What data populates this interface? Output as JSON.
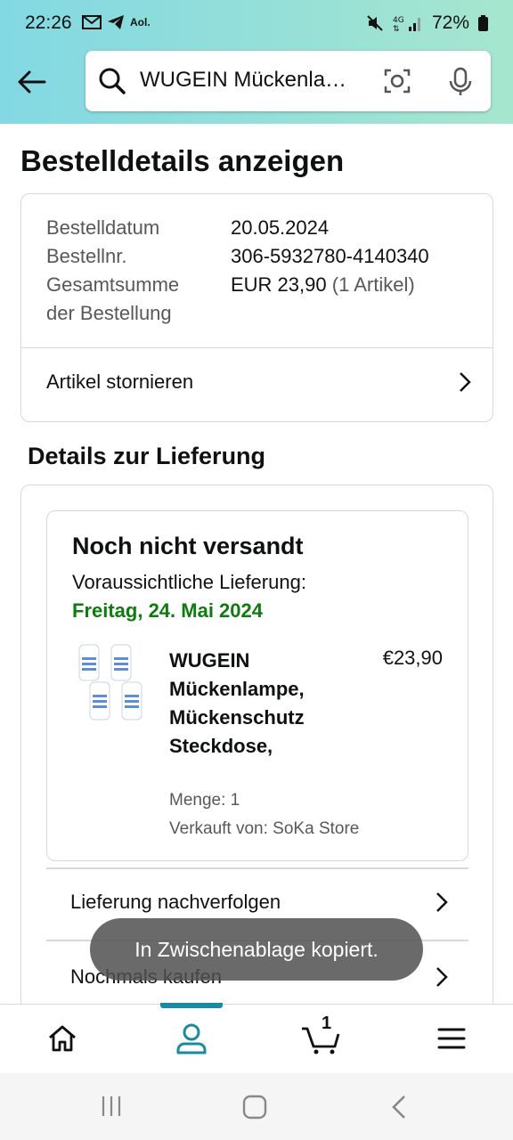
{
  "status_bar": {
    "time": "22:26",
    "notif_aol": "Aol.",
    "battery": "72%"
  },
  "search": {
    "query": "WUGEIN Mückenlampe, Mückenschutz Steckdose,"
  },
  "page": {
    "title": "Bestelldetails anzeigen"
  },
  "order_summary": {
    "date_label": "Bestelldatum",
    "date_value": "20.05.2024",
    "number_label": "Bestellnr.",
    "number_value": "306-5932780-4140340",
    "total_label_line1": "Gesamtsumme",
    "total_label_line2": "der Bestellung",
    "total_value": "EUR 23,90",
    "total_items": "(1 Artikel)",
    "cancel_label": "Artikel stornieren"
  },
  "delivery": {
    "section_title": "Details zur Lieferung",
    "status": "Noch nicht versandt",
    "estimate_label": "Voraussichtliche Lieferung:",
    "estimate_date": "Freitag, 24. Mai 2024",
    "item": {
      "name_lines": [
        "WUGEIN",
        "Mückenlampe,",
        "Mückenschutz",
        "Steckdose,"
      ],
      "price": "€23,90",
      "quantity": "Menge: 1",
      "seller": "Verkauft von: SoKa Store"
    },
    "track_label": "Lieferung nachverfolgen",
    "buy_again_label": "Nochmals kaufen"
  },
  "toast": {
    "message": "In Zwischenablage kopiert."
  },
  "bottom_nav": {
    "cart_count": "1",
    "active": "account"
  },
  "colors": {
    "header_gradient_start": "#82d8e3",
    "header_gradient_end": "#a6e6ce",
    "delivery_date": "#0f7a0f",
    "nav_indicator": "#1a8aa0"
  }
}
